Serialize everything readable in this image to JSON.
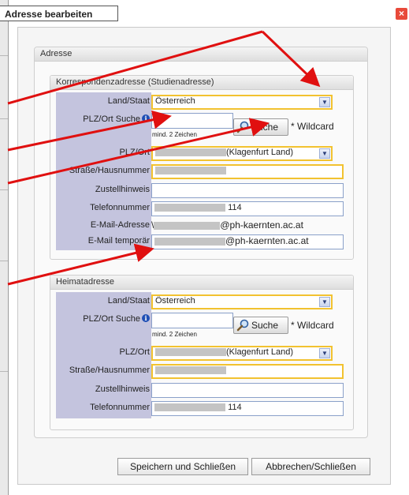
{
  "title": "Adresse bearbeiten",
  "close_glyph": "×",
  "section_address": "Adresse",
  "correspondence": {
    "header": "Korrespondenzadresse (Studienadresse)",
    "labels": {
      "country": "Land/Staat",
      "plz_search": "PLZ/Ort Suche",
      "plz_city": "PLZ/Ort",
      "street": "Straße/Hausnummer",
      "delivery_note": "Zustellhinweis",
      "phone": "Telefonnummer",
      "email": "E-Mail-Adresse",
      "email_temp": "E-Mail temporär"
    },
    "values": {
      "country": "Österreich",
      "plz_search": "",
      "plz_city": "(Klagenfurt Land)",
      "street": "",
      "delivery_note": "",
      "phone": "114",
      "email": "@ph-kaernten.ac.at",
      "email_temp": "@ph-kaernten.ac.at"
    },
    "email_prefix": "\\"
  },
  "home": {
    "header": "Heimatadresse",
    "labels": {
      "country": "Land/Staat",
      "plz_search": "PLZ/Ort Suche",
      "plz_city": "PLZ/Ort",
      "street": "Straße/Hausnummer",
      "delivery_note": "Zustellhinweis",
      "phone": "Telefonnummer"
    },
    "values": {
      "country": "Österreich",
      "plz_search": "",
      "plz_city": "(Klagenfurt Land)",
      "street": "",
      "delivery_note": "",
      "phone": "114"
    }
  },
  "hint_min_chars": "mind. 2 Zeichen",
  "search_button": "Suche",
  "wildcard_text": "* Wildcard",
  "info_glyph": "i",
  "dropdown_glyph": "▼",
  "buttons": {
    "save_close": "Speichern und Schließen",
    "cancel_close": "Abbrechen/Schließen"
  },
  "colors": {
    "label_bg": "#c4c4de",
    "required_border": "#f2c230",
    "annotation_arrow": "#e01010",
    "close_button": "#e84a3a"
  },
  "icons": [
    "close-icon",
    "info-icon",
    "search-magnifier-icon",
    "dropdown-arrow-icon"
  ]
}
